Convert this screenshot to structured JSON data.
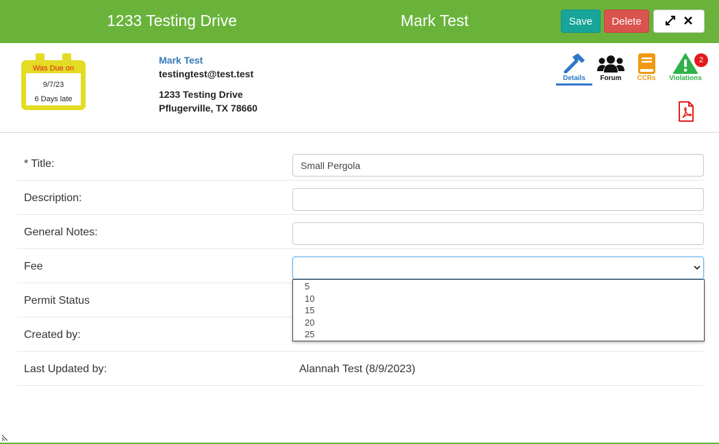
{
  "header": {
    "address": "1233 Testing Drive",
    "owner": "Mark Test",
    "save_label": "Save",
    "delete_label": "Delete",
    "expand_icon": "expand-icon",
    "close_icon": "close-icon"
  },
  "due": {
    "label": "Was Due on",
    "date": "9/7/23",
    "late": "6 Days late"
  },
  "contact": {
    "name": "Mark Test",
    "email": "testingtest@test.test",
    "street": "1233 Testing Drive",
    "city": "Pflugerville, TX 78660"
  },
  "tabs": [
    {
      "label": "Details",
      "icon": "hammer-icon",
      "color": "#2e77c6",
      "active": true
    },
    {
      "label": "Forum",
      "icon": "users-icon",
      "color": "#111111"
    },
    {
      "label": "CCRs",
      "icon": "book-icon",
      "color": "#ef9a12"
    },
    {
      "label": "Violations",
      "icon": "warning-icon",
      "color": "#2fb24a",
      "badge": "2"
    }
  ],
  "pdf_icon": "pdf-icon",
  "form": {
    "title_label": "* Title:",
    "title_value": "Small Pergola",
    "description_label": "Description:",
    "description_value": "",
    "notes_label": "General Notes:",
    "notes_value": "",
    "fee_label": "Fee",
    "fee_value": "",
    "fee_options": [
      "5",
      "10",
      "15",
      "20",
      "25"
    ],
    "status_label": "Permit Status",
    "created_label": "Created by:",
    "updated_label": "Last Updated by:",
    "updated_value": "Alannah Test (8/9/2023)"
  },
  "colors": {
    "header": "#69b33b",
    "save": "#17a59a",
    "delete": "#d9534f",
    "due_calendar": "#e3db24",
    "link": "#337ab7"
  }
}
